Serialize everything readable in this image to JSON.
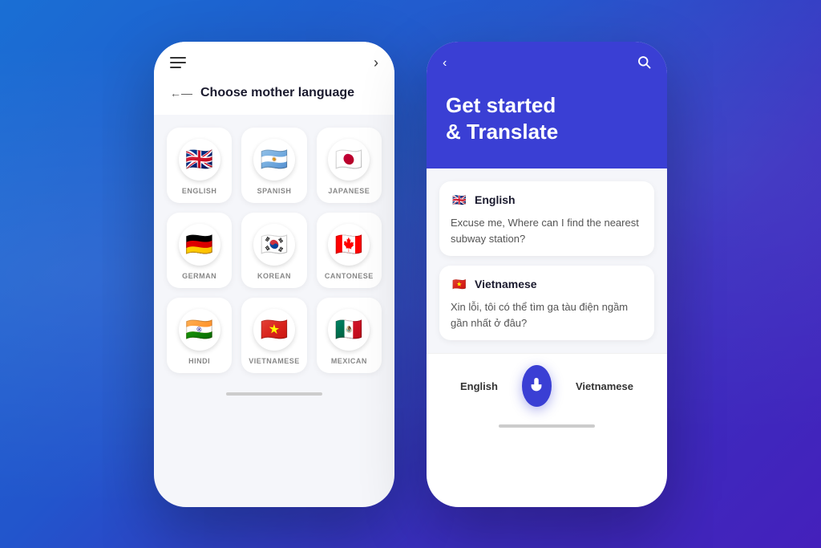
{
  "background": {
    "gradient_start": "#1a6fd4",
    "gradient_end": "#4420bb"
  },
  "phone_left": {
    "header": {
      "back_label": "←",
      "title": "Choose mother language"
    },
    "languages": [
      {
        "name": "ENGLISH",
        "flag": "🇬🇧"
      },
      {
        "name": "SPANISH",
        "flag": "🇦🇷"
      },
      {
        "name": "JAPANESE",
        "flag": "🇯🇵"
      },
      {
        "name": "GERMAN",
        "flag": "🇩🇪"
      },
      {
        "name": "KOREAN",
        "flag": "🇰🇷"
      },
      {
        "name": "CANTONESE",
        "flag": "🇨🇦"
      },
      {
        "name": "HINDI",
        "flag": "🇮🇳"
      },
      {
        "name": "VIETNAMESE",
        "flag": "🇻🇳"
      },
      {
        "name": "MEXICAN",
        "flag": "🇲🇽"
      }
    ]
  },
  "phone_right": {
    "hero_title": "Get started\n& Translate",
    "source_language": {
      "name": "English",
      "flag": "🇬🇧",
      "text": "Excuse me, Where can I find the nearest subway station?"
    },
    "target_language": {
      "name": "Vietnamese",
      "flag": "🇻🇳",
      "text": "Xin lỗi, tôi có thể tìm ga tàu điện ngầm gần nhất ở đâu?"
    },
    "bottom_controls": {
      "left_label": "English",
      "right_label": "Vietnamese",
      "mic_label": "microphone"
    }
  }
}
